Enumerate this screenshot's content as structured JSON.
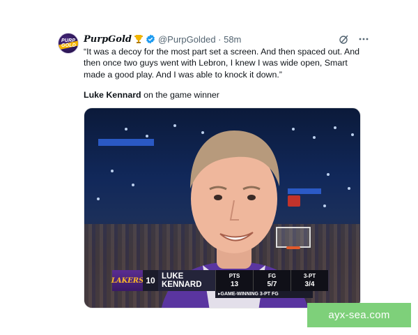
{
  "tweet": {
    "display_name": "PurpGold",
    "avatar_text": "PURP GOLD",
    "handle": "@PurpGolded · 58m",
    "quote": "“It was a decoy for the most part set a screen. And then spaced out. And then once two guys went with Lebron, I knew I was wide open, Smart made a good play. And I was able to knock it down.”",
    "caption_name": "Luke Kennard",
    "caption_rest": " on the game winner"
  },
  "scorebug": {
    "team_logo": "LAKERS",
    "number": "10",
    "first_name": "LUKE",
    "last_name": "KENNARD",
    "stats": [
      {
        "label": "PTS",
        "value": "13"
      },
      {
        "label": "FG",
        "value": "5/7"
      },
      {
        "label": "3-PT",
        "value": "3/4"
      }
    ],
    "footer": "▸GAME-WINNING 3-PT FG"
  },
  "watermark": "ayx-sea.com",
  "colors": {
    "lakers_purple": "#552583",
    "lakers_gold": "#fdb927",
    "watermark_bg": "#7ed07a",
    "muted_text": "#536471"
  },
  "icons": [
    "verified-badge-icon",
    "trophy-icon",
    "grok-icon",
    "more-icon"
  ]
}
